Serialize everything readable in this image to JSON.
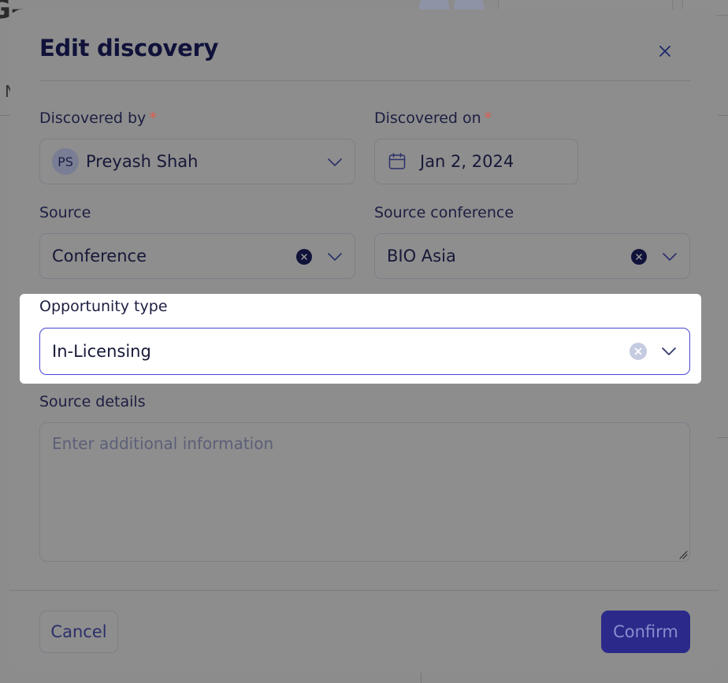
{
  "modal": {
    "title": "Edit discovery",
    "close_icon": "close-icon"
  },
  "fields": {
    "discovered_by": {
      "label": "Discovered by",
      "required_mark": "*",
      "avatar_initials": "PS",
      "value": "Preyash Shah"
    },
    "discovered_on": {
      "label": "Discovered on",
      "required_mark": "*",
      "icon": "calendar-icon",
      "value": "Jan 2, 2024"
    },
    "source": {
      "label": "Source",
      "value": "Conference"
    },
    "source_conference": {
      "label": "Source conference",
      "value": "BIO Asia"
    },
    "opportunity_type": {
      "label": "Opportunity type",
      "value": "In-Licensing"
    },
    "source_details": {
      "label": "Source details",
      "placeholder": "Enter additional information"
    }
  },
  "footer": {
    "cancel_label": "Cancel",
    "confirm_label": "Confirm"
  },
  "colors": {
    "overlay": "#8a8a8a",
    "accent": "#4746d6",
    "confirm_bg_dimmed": "#2b2a8a",
    "required": "#e05a4a",
    "title": "#10123a"
  }
}
